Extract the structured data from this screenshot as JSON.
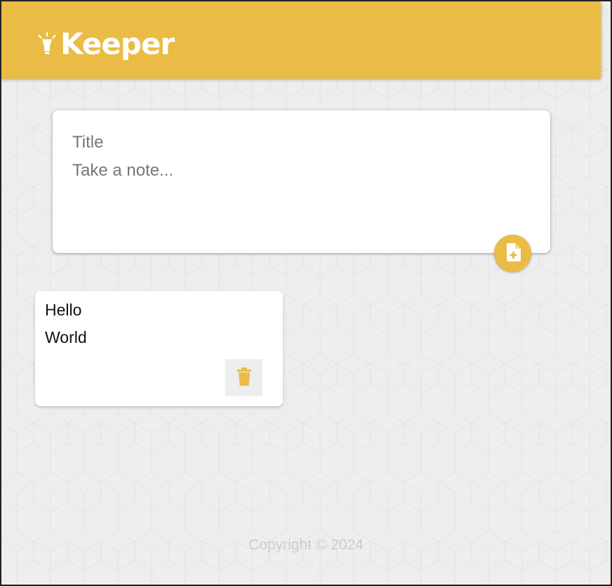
{
  "header": {
    "title": "Keeper",
    "logo_icon": "lightbulb-icon",
    "color": "#eabb45"
  },
  "create_area": {
    "title_placeholder": "Title",
    "content_placeholder": "Take a note...",
    "add_icon": "note-add-icon"
  },
  "notes": [
    {
      "title": "Hello",
      "content": "World",
      "delete_icon": "trash-icon"
    }
  ],
  "footer": {
    "copyright": "Copyright © 2024"
  }
}
